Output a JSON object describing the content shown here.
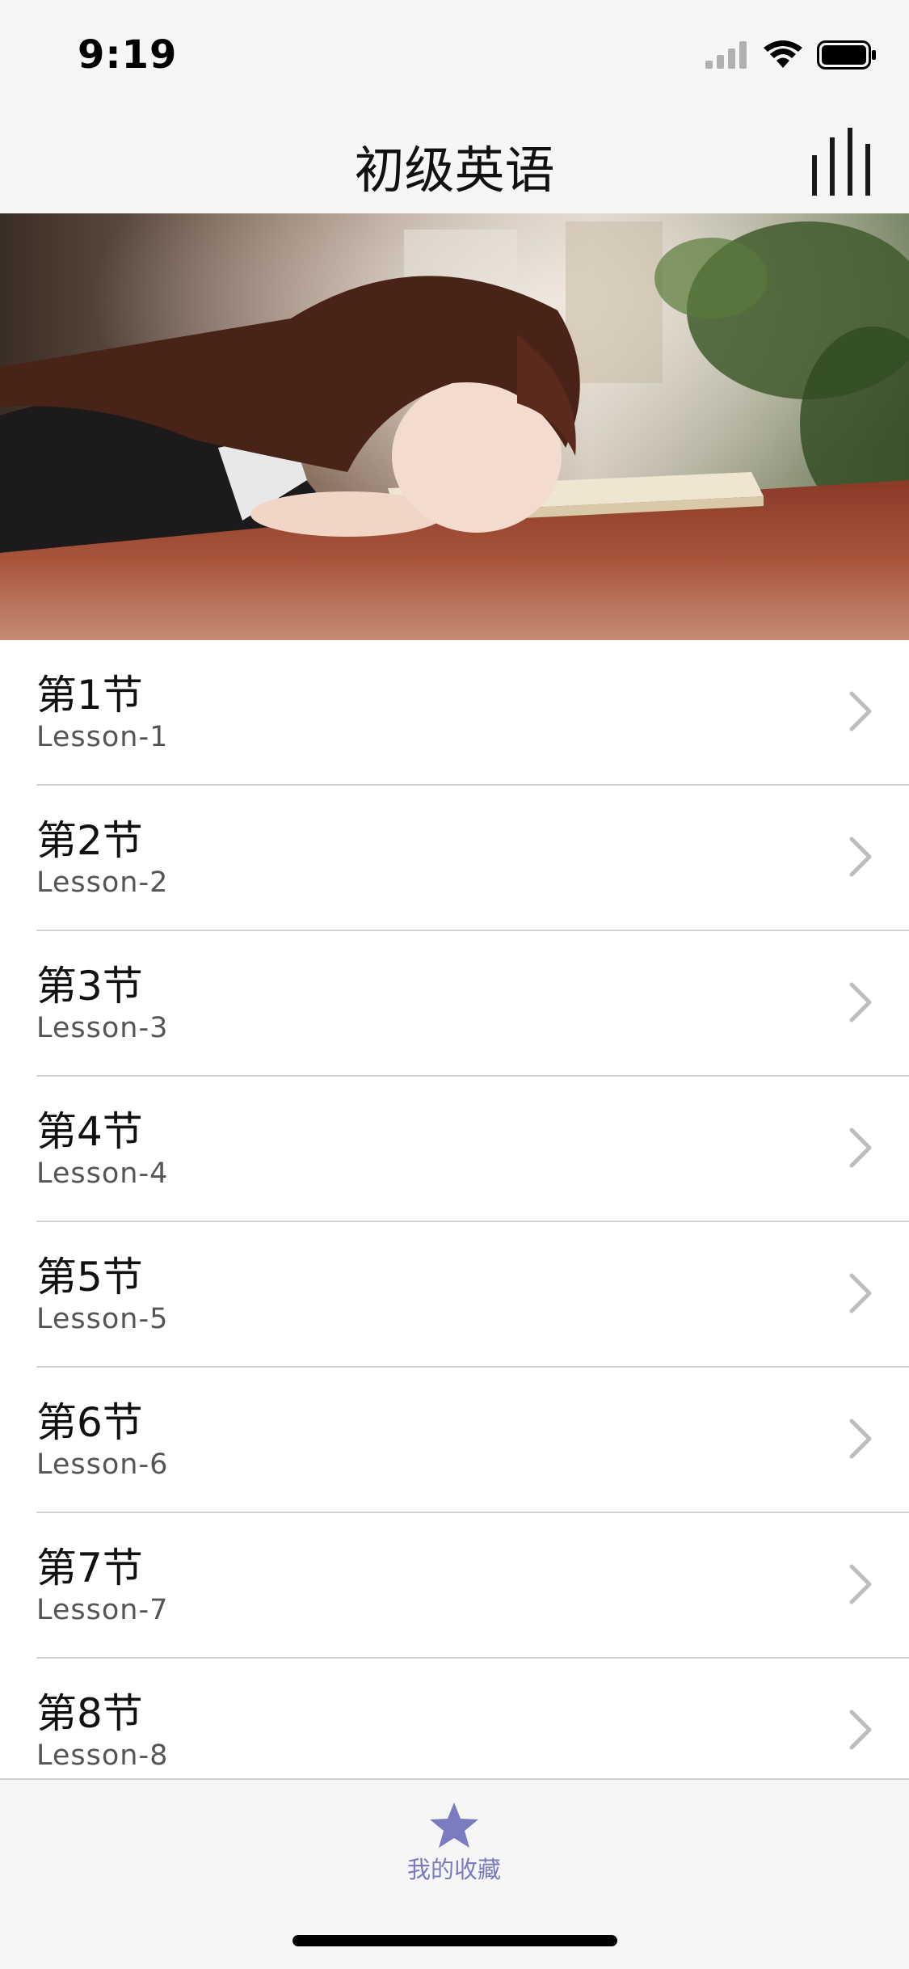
{
  "status_bar": {
    "time": "9:19",
    "icons": [
      "cellular-signal-icon",
      "wifi-icon",
      "battery-icon"
    ]
  },
  "nav_bar": {
    "title": "初级英语",
    "action_icon": "stats-bars-icon"
  },
  "banner": {
    "image": "girl-reading-book-photo"
  },
  "lessons": [
    {
      "title": "第1节",
      "subtitle": "Lesson-1"
    },
    {
      "title": "第2节",
      "subtitle": "Lesson-2"
    },
    {
      "title": "第3节",
      "subtitle": "Lesson-3"
    },
    {
      "title": "第4节",
      "subtitle": "Lesson-4"
    },
    {
      "title": "第5节",
      "subtitle": "Lesson-5"
    },
    {
      "title": "第6节",
      "subtitle": "Lesson-6"
    },
    {
      "title": "第7节",
      "subtitle": "Lesson-7"
    },
    {
      "title": "第8节",
      "subtitle": "Lesson-8"
    }
  ],
  "tab_bar": {
    "items": [
      {
        "label": "我的收藏",
        "icon": "star-icon",
        "selected": true
      }
    ]
  },
  "colors": {
    "bar_background": "#f6f6f6",
    "accent": "#7b7bbf",
    "chevron": "#bdbdc2",
    "divider": "#d4d4d8"
  }
}
